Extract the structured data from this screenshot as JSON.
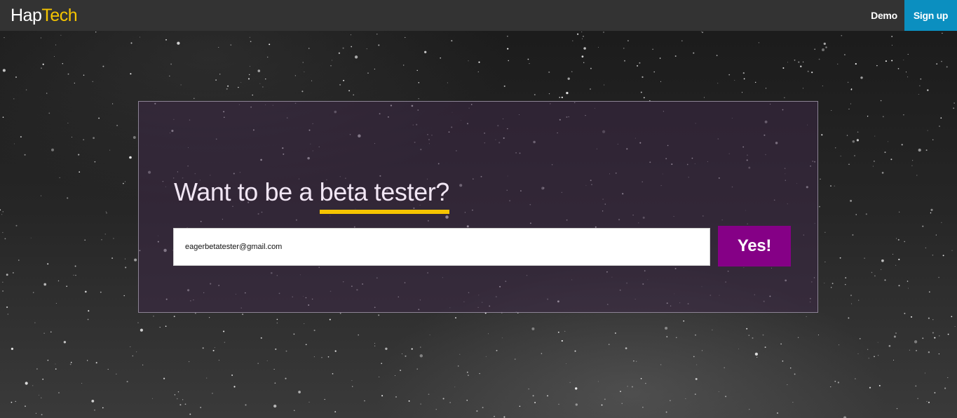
{
  "brand": {
    "part1": "Hap",
    "part2": "Tech"
  },
  "nav": {
    "demo_label": "Demo",
    "signup_label": "Sign up"
  },
  "signup": {
    "headline_prefix": "Want to be a ",
    "headline_highlight": "beta tester?",
    "email_value": "eagerbetatester@gmail.com",
    "submit_label": "Yes!"
  },
  "colors": {
    "navbar_bg": "#333333",
    "brand_accent": "#f5c400",
    "signup_nav_bg": "#0b8fc0",
    "submit_bg": "#850086",
    "underline": "#f5c400"
  }
}
